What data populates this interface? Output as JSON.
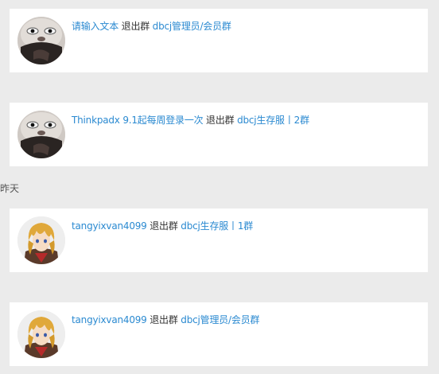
{
  "colors": {
    "page_bg": "#ebebeb",
    "card_bg": "#ffffff",
    "link": "#2b8ad1",
    "text": "#333333"
  },
  "date_header": "昨天",
  "messages": [
    {
      "avatar": "sloth-avatar",
      "user": "请输入文本",
      "action": "退出群",
      "group": "dbcj管理员/会员群"
    },
    {
      "avatar": "sloth-avatar",
      "user": "Thinkpadx 9.1起每周登录一次",
      "action": "退出群",
      "group": "dbcj生存服丨2群"
    },
    {
      "avatar": "anime-avatar",
      "user": "tangyixvan4099",
      "action": "退出群",
      "group": "dbcj生存服丨1群"
    },
    {
      "avatar": "anime-avatar",
      "user": "tangyixvan4099",
      "action": "退出群",
      "group": "dbcj管理员/会员群"
    }
  ]
}
